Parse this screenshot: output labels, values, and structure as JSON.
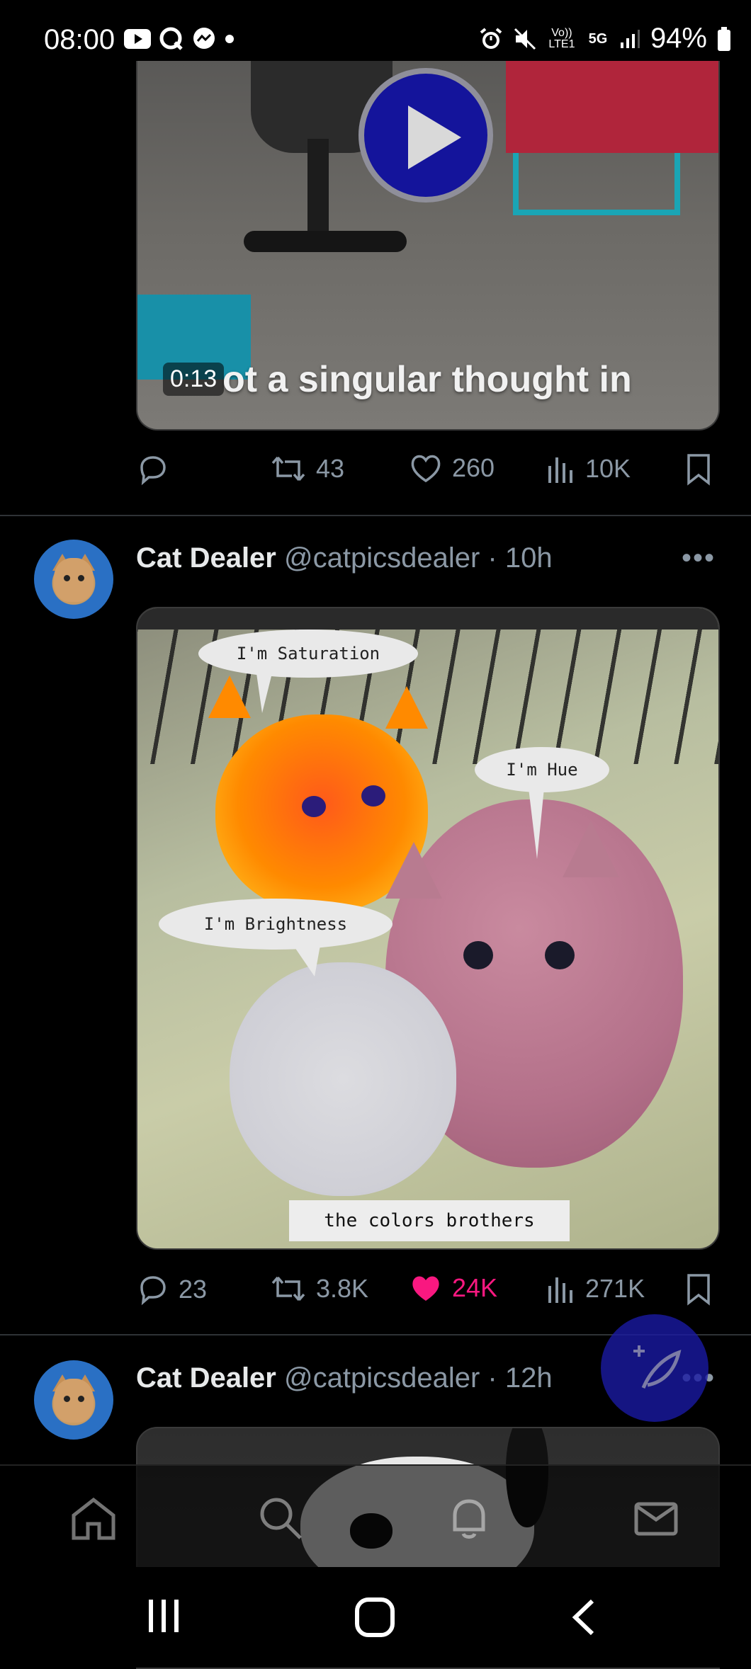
{
  "status_bar": {
    "time": "08:00",
    "left_icons": [
      "youtube-icon",
      "q-icon",
      "messenger-icon",
      "dot-icon"
    ],
    "right_icons": [
      "alarm-icon",
      "mute-icon",
      "volte-icon",
      "5g-icon",
      "signal-icon"
    ],
    "volte_label": "Vo)) LTE1",
    "network_label": "5G",
    "battery_percent": "94%"
  },
  "tweets": [
    {
      "media": {
        "type": "video",
        "duration": "0:13",
        "overlay_caption": "ot a singular thought in"
      },
      "actions": {
        "replies": "",
        "reposts": "43",
        "likes": "260",
        "views": "10K",
        "liked": false
      }
    },
    {
      "author": {
        "name": "Cat Dealer",
        "handle": "@catpicsdealer",
        "time": "10h"
      },
      "media": {
        "type": "image",
        "bubbles": {
          "saturation": "I'm Saturation",
          "hue": "I'm Hue",
          "brightness": "I'm Brightness"
        },
        "caption": "the colors brothers"
      },
      "actions": {
        "replies": "23",
        "reposts": "3.8K",
        "likes": "24K",
        "views": "271K",
        "liked": true
      }
    },
    {
      "author": {
        "name": "Cat Dealer",
        "handle": "@catpicsdealer",
        "time": "12h"
      },
      "media": {
        "type": "image"
      }
    }
  ],
  "separator": "·",
  "colors": {
    "like_active": "#f91880",
    "action_gray": "#8b98a5",
    "compose_bg": "#1a1aa3",
    "play_bg": "#14149b"
  },
  "bottom_nav": [
    "home-icon",
    "search-icon",
    "notifications-icon",
    "messages-icon"
  ],
  "system_nav": [
    "recent-apps-icon",
    "home-icon",
    "back-icon"
  ]
}
